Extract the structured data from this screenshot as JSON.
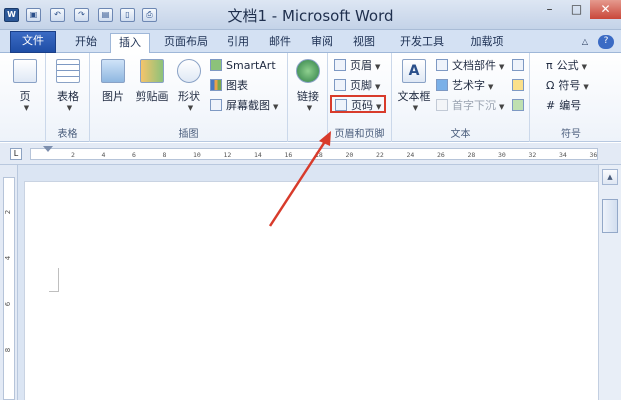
{
  "window": {
    "title": "文档1 - Microsoft Word",
    "app_icon": "W"
  },
  "quick_access": {
    "save_icon": "save-icon",
    "undo_icon": "undo-icon",
    "redo_icon": "redo-icon"
  },
  "window_controls": {
    "minimize": "–",
    "restore": "□",
    "close": "✕"
  },
  "tabs": {
    "file": "文件",
    "home": "开始",
    "insert": "插入",
    "page_layout": "页面布局",
    "references": "引用",
    "mailings": "邮件",
    "review": "审阅",
    "view": "视图",
    "developer": "开发工具",
    "addins": "加载项"
  },
  "ribbon": {
    "pages": {
      "label": "页",
      "group": ""
    },
    "tables": {
      "label": "表格",
      "group": "表格"
    },
    "illustrations": {
      "group": "插图",
      "picture": "图片",
      "clipart": "剪贴画",
      "shapes": "形状",
      "smartart": "SmartArt",
      "chart": "图表",
      "screenshot": "屏幕截图"
    },
    "links": {
      "label": "链接"
    },
    "header_footer": {
      "group": "页眉和页脚",
      "header": "页眉",
      "footer": "页脚",
      "page_number": "页码"
    },
    "text": {
      "group": "文本",
      "textbox": "文本框",
      "quick_parts": "文档部件",
      "wordart": "艺术字",
      "dropcap": "首字下沉"
    },
    "symbols": {
      "group": "符号",
      "equation": "公式",
      "symbol": "符号",
      "number": "编号"
    }
  },
  "ruler": {
    "ticks": [
      "2",
      "4",
      "6",
      "8",
      "10",
      "12",
      "14",
      "16",
      "18",
      "20",
      "22",
      "24",
      "26",
      "28",
      "30",
      "32",
      "34",
      "36"
    ]
  },
  "vruler": {
    "ticks": [
      "2",
      "4",
      "6",
      "8"
    ]
  },
  "colors": {
    "accent": "#1f4ea6",
    "annotation": "#d83b2b"
  }
}
